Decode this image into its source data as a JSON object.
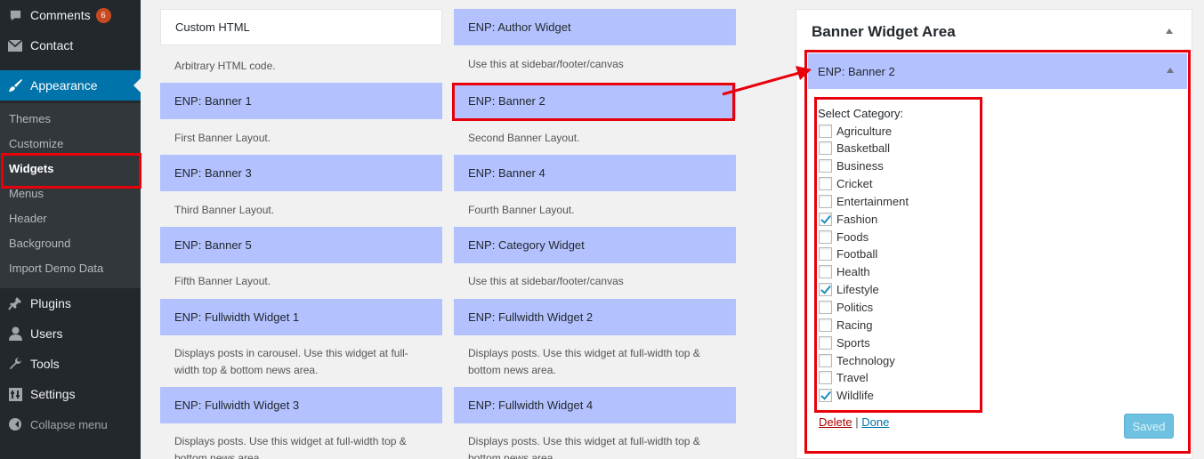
{
  "sidebar": {
    "comments": {
      "label": "Comments",
      "badge": "6"
    },
    "contact": "Contact",
    "appearance": "Appearance",
    "submenu": [
      "Themes",
      "Customize",
      "Widgets",
      "Menus",
      "Header",
      "Background",
      "Import Demo Data"
    ],
    "plugins": "Plugins",
    "users": "Users",
    "tools": "Tools",
    "settings": "Settings",
    "collapse": "Collapse menu"
  },
  "widgets": [
    {
      "title": "Custom HTML",
      "desc": "Arbitrary HTML code."
    },
    {
      "title": "ENP: Author Widget",
      "desc": "Use this at sidebar/footer/canvas"
    },
    {
      "title": "ENP: Banner 1",
      "desc": "First Banner Layout."
    },
    {
      "title": "ENP: Banner 2",
      "desc": "Second Banner Layout."
    },
    {
      "title": "ENP: Banner 3",
      "desc": "Third Banner Layout."
    },
    {
      "title": "ENP: Banner 4",
      "desc": "Fourth Banner Layout."
    },
    {
      "title": "ENP: Banner 5",
      "desc": "Fifth Banner Layout."
    },
    {
      "title": "ENP: Category Widget",
      "desc": "Use this at sidebar/footer/canvas"
    },
    {
      "title": "ENP: Fullwidth Widget 1",
      "desc": "Displays posts in carousel. Use this widget at full-width top & bottom news area."
    },
    {
      "title": "ENP: Fullwidth Widget 2",
      "desc": "Displays posts. Use this widget at full-width top & bottom news area."
    },
    {
      "title": "ENP: Fullwidth Widget 3",
      "desc": "Displays posts. Use this widget at full-width top & bottom news area."
    },
    {
      "title": "ENP: Fullwidth Widget 4",
      "desc": "Displays posts. Use this widget at full-width top & bottom news area."
    }
  ],
  "area": {
    "title": "Banner Widget Area",
    "widget_title": "ENP: Banner 2",
    "category_label": "Select Category:",
    "categories": [
      {
        "name": "Agriculture",
        "checked": false
      },
      {
        "name": "Basketball",
        "checked": false
      },
      {
        "name": "Business",
        "checked": false
      },
      {
        "name": "Cricket",
        "checked": false
      },
      {
        "name": "Entertainment",
        "checked": false
      },
      {
        "name": "Fashion",
        "checked": true
      },
      {
        "name": "Foods",
        "checked": false
      },
      {
        "name": "Football",
        "checked": false
      },
      {
        "name": "Health",
        "checked": false
      },
      {
        "name": "Lifestyle",
        "checked": true
      },
      {
        "name": "Politics",
        "checked": false
      },
      {
        "name": "Racing",
        "checked": false
      },
      {
        "name": "Sports",
        "checked": false
      },
      {
        "name": "Technology",
        "checked": false
      },
      {
        "name": "Travel",
        "checked": false
      },
      {
        "name": "Wildlife",
        "checked": true
      }
    ],
    "delete_label": "Delete",
    "separator": "|",
    "done_label": "Done",
    "saved_label": "Saved"
  },
  "colors": {
    "sidebar_bg": "#23282d",
    "accent": "#0073aa",
    "widget_bg": "#b3c2ff",
    "annotation": "#e8000a"
  }
}
